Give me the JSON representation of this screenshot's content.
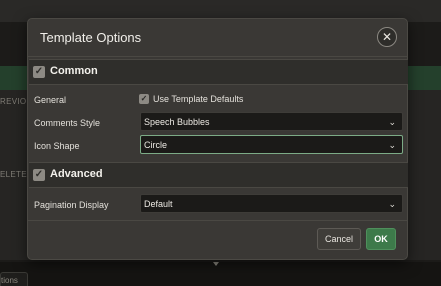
{
  "background": {
    "side_text_1": "REVIOU",
    "side_text_2": "ELETE",
    "bottom_tab": "tions"
  },
  "dialog": {
    "title": "Template Options",
    "close_icon": "close-icon",
    "sections": {
      "common": {
        "label": "Common",
        "expanded": true
      },
      "advanced": {
        "label": "Advanced",
        "expanded": true
      }
    },
    "fields": {
      "general_label": "General",
      "use_defaults_label": "Use Template Defaults",
      "use_defaults_checked": true,
      "comments_style_label": "Comments Style",
      "comments_style_value": "Speech Bubbles",
      "icon_shape_label": "Icon Shape",
      "icon_shape_value": "Circle",
      "pagination_label": "Pagination Display",
      "pagination_value": "Default"
    },
    "buttons": {
      "cancel": "Cancel",
      "ok": "OK"
    }
  },
  "colors": {
    "accent_green": "#3d7a4a",
    "focus_border": "#7cab86"
  }
}
